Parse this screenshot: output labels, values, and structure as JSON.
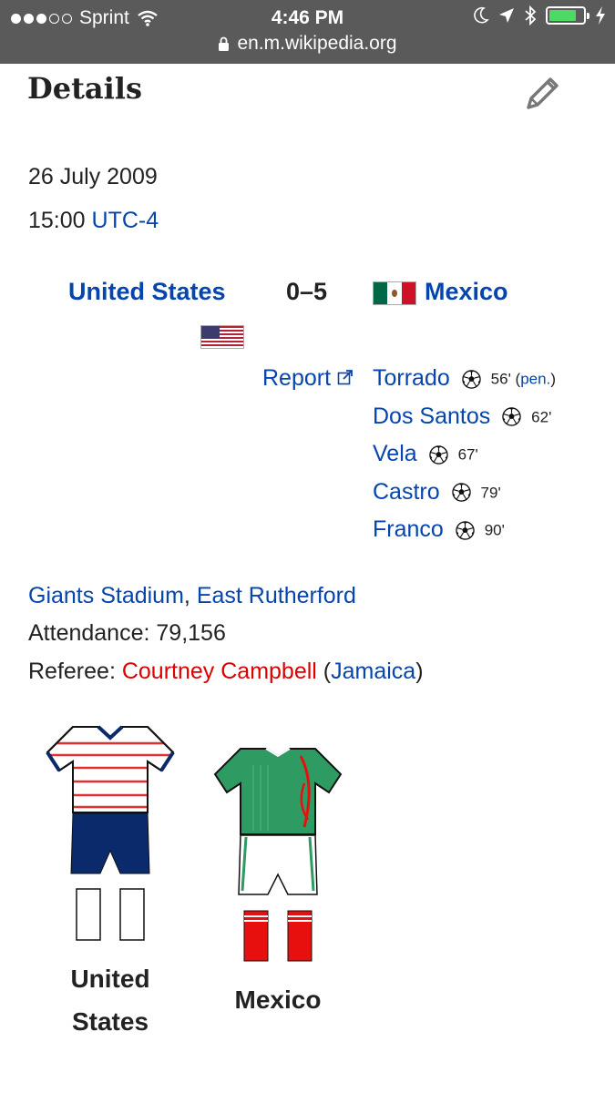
{
  "status_bar": {
    "carrier": "Sprint",
    "time": "4:46 PM",
    "url": "en.m.wikipedia.org",
    "battery_level": 0.8
  },
  "page": {
    "heading": "Details"
  },
  "match": {
    "date": "26 July 2009",
    "time": "15:00",
    "timezone": "UTC-4",
    "home_team": "United States",
    "score": "0–5",
    "away_team": "Mexico",
    "report_label": "Report",
    "goals": [
      {
        "scorer": "Torrado",
        "minute": "56'",
        "note": "pen."
      },
      {
        "scorer": "Dos Santos",
        "minute": "62'"
      },
      {
        "scorer": "Vela",
        "minute": "67'"
      },
      {
        "scorer": "Castro",
        "minute": "79'"
      },
      {
        "scorer": "Franco",
        "minute": "90'"
      }
    ],
    "stadium": "Giants Stadium",
    "city": "East Rutherford",
    "attendance_label": "Attendance:",
    "attendance": "79,156",
    "referee_label": "Referee:",
    "referee": "Courtney Campbell",
    "referee_country": "Jamaica"
  },
  "kits": {
    "home_label_line1": "United",
    "home_label_line2": "States",
    "away_label": "Mexico"
  },
  "colors": {
    "link": "#0645ad",
    "red_link": "#dd0000",
    "usa_shorts": "#0b2a6b",
    "mexico_shirt": "#2e9b63",
    "mexico_socks": "#e8100f"
  },
  "icons": [
    "lock-icon",
    "wifi-icon",
    "moon-icon",
    "location-icon",
    "bluetooth-icon",
    "battery-icon",
    "charging-icon",
    "edit-pencil-icon",
    "external-link-icon",
    "football-icon"
  ]
}
